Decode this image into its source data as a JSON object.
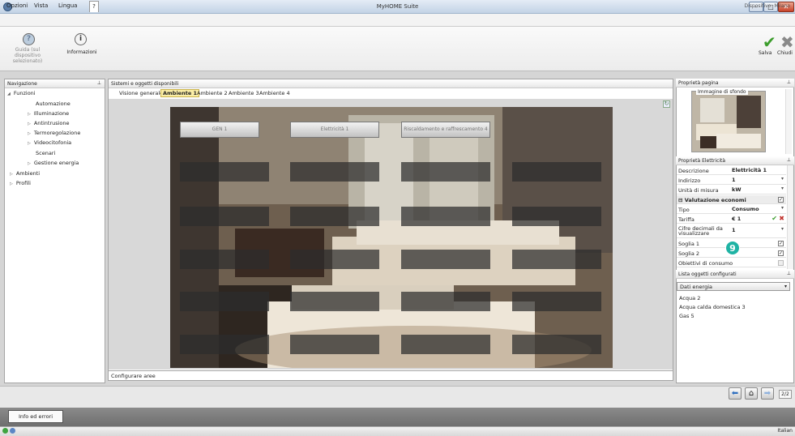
{
  "window": {
    "title": "MyHOME Suite",
    "user": "Dispositivo: Milano"
  },
  "menu": {
    "items": [
      "Opzioni",
      "Vista",
      "Lingua",
      "?"
    ]
  },
  "ribbon": {
    "guide_label": "Guida (sul dispositivo selezionato)",
    "info_label": "Informazioni",
    "save_label": "Salva",
    "close_label": "Chiudi"
  },
  "navigation": {
    "title": "Navigazione",
    "root": "Funzioni",
    "items": [
      "Automazione",
      "Illuminazione",
      "Antintrusione",
      "Termoregolazione",
      "Videocitofonia",
      "Scenari",
      "Gestione energia"
    ],
    "ambienti": "Ambienti",
    "profili": "Profili"
  },
  "center": {
    "title": "Sistemi e oggetti disponibili",
    "tabs": [
      "Visione generale",
      "Ambiente 1",
      "Ambiente 2",
      "Ambiente 3",
      "Ambiente 4"
    ],
    "active_tab": "Ambiente 1",
    "area_buttons": [
      "GEN 1",
      "Elettricità 1",
      "Riscaldamento e raffrescamento 4"
    ],
    "status": "Configurare aree"
  },
  "page_props": {
    "title": "Proprietà pagina",
    "bg_label": "Immagine di sfondo"
  },
  "electricity_props": {
    "title": "Proprietà Elettricità",
    "rows": [
      {
        "label": "Descrizione",
        "value": "Elettricità 1"
      },
      {
        "label": "Indirizzo",
        "value": "1"
      },
      {
        "label": "Unità di misura",
        "value": "kW"
      },
      {
        "label": "Valutazione economi"
      },
      {
        "label": "Tipo",
        "value": "Consumo"
      },
      {
        "label": "Tariffa",
        "value": "€ 1"
      },
      {
        "label": "Cifre decimali da visualizzare",
        "value": "1"
      },
      {
        "label": "Soglia 1"
      },
      {
        "label": "Soglia 2"
      },
      {
        "label": "Obiettivi di consumo"
      }
    ],
    "badge": "9"
  },
  "configured_list": {
    "title": "Lista oggetti configurati",
    "filter": "Dati energia",
    "items": [
      "Acqua 2",
      "Acqua calda domestica 3",
      "Gas 5"
    ]
  },
  "pager": "2/2",
  "errors_button": "Info ed errori",
  "language": "Italian",
  "colors": {
    "accent_tab": "#fbeea6",
    "badge": "#1fb3a4",
    "save": "#3c9d2c"
  }
}
